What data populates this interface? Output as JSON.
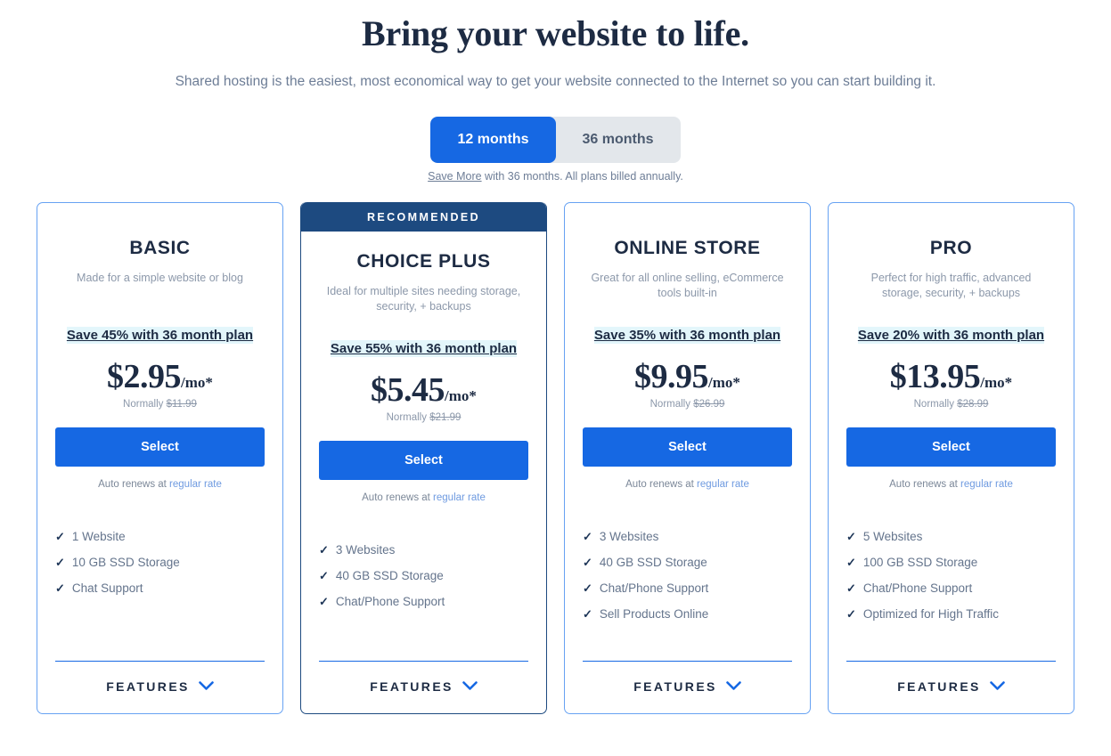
{
  "hero": {
    "title": "Bring your website to life.",
    "subtitle": "Shared hosting is the easiest, most economical way to get your website connected to the Internet so you can start building it."
  },
  "term_toggle": {
    "options": [
      {
        "label": "12 months",
        "active": true
      },
      {
        "label": "36 months",
        "active": false
      }
    ],
    "note_link": "Save More",
    "note_rest": " with 36 months. All plans billed annually.",
    "active_bg": "#1668e3",
    "inactive_bg": "#e3e7eb"
  },
  "colors": {
    "accent_blue": "#1668e3",
    "card_border": "#67a2f3",
    "ribbon_navy": "#1d4a80",
    "save_highlight": "#e3f6fb",
    "heading_navy": "#1d2b43",
    "muted_text": "#8c98aa"
  },
  "features_toggle_label": "FEATURES",
  "plans": [
    {
      "ribbon": "",
      "name": "BASIC",
      "description": "Made for a simple website or blog",
      "save_text": "Save 45% with 36 month plan",
      "price": "$2.95",
      "price_unit": "/mo*",
      "normally_prefix": "Normally ",
      "normally_price": "$11.99",
      "cta": "Select",
      "renew_prefix": "Auto renews at ",
      "renew_link": "regular rate",
      "features": [
        "1 Website",
        "10 GB SSD Storage",
        "Chat Support"
      ]
    },
    {
      "ribbon": "RECOMMENDED",
      "name": "CHOICE PLUS",
      "description": "Ideal for multiple sites needing storage, security, + backups",
      "save_text": "Save 55% with 36 month plan",
      "price": "$5.45",
      "price_unit": "/mo*",
      "normally_prefix": "Normally ",
      "normally_price": "$21.99",
      "cta": "Select",
      "renew_prefix": "Auto renews at ",
      "renew_link": "regular rate",
      "features": [
        "3 Websites",
        "40 GB SSD Storage",
        "Chat/Phone Support"
      ]
    },
    {
      "ribbon": "",
      "name": "ONLINE STORE",
      "description": "Great for all online selling, eCommerce tools built-in",
      "save_text": "Save 35% with 36 month plan",
      "price": "$9.95",
      "price_unit": "/mo*",
      "normally_prefix": "Normally ",
      "normally_price": "$26.99",
      "cta": "Select",
      "renew_prefix": "Auto renews at ",
      "renew_link": "regular rate",
      "features": [
        "3 Websites",
        "40 GB SSD Storage",
        "Chat/Phone Support",
        "Sell Products Online"
      ]
    },
    {
      "ribbon": "",
      "name": "PRO",
      "description": "Perfect for high traffic, advanced storage, security, + backups",
      "save_text": "Save 20% with 36 month plan",
      "price": "$13.95",
      "price_unit": "/mo*",
      "normally_prefix": "Normally ",
      "normally_price": "$28.99",
      "cta": "Select",
      "renew_prefix": "Auto renews at ",
      "renew_link": "regular rate",
      "features": [
        "5 Websites",
        "100 GB SSD Storage",
        "Chat/Phone Support",
        "Optimized for High Traffic"
      ]
    }
  ]
}
